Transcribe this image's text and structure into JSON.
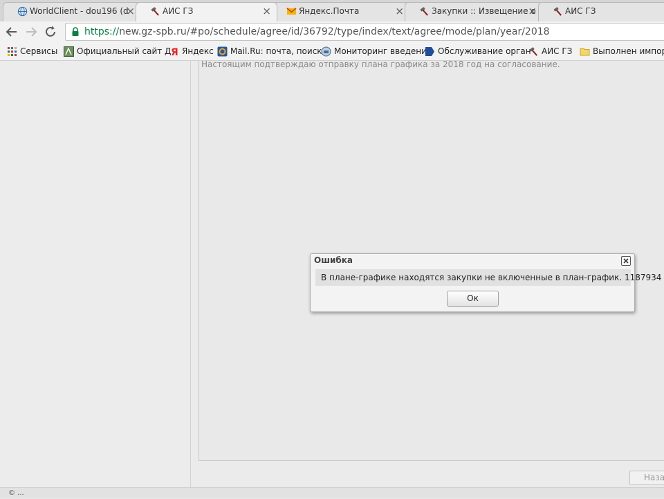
{
  "tabs": [
    {
      "title": "WorldClient - dou196 (d",
      "icon": "globe-icon",
      "active": false
    },
    {
      "title": "АИС ГЗ",
      "icon": "hammer-icon",
      "active": true
    },
    {
      "title": "Яндекс.Почта",
      "icon": "mail-icon",
      "active": false
    },
    {
      "title": "Закупки :: Извещение о",
      "icon": "hammer-icon",
      "active": false
    },
    {
      "title": "АИС ГЗ",
      "icon": "hammer-icon",
      "active": false
    }
  ],
  "address": {
    "scheme": "https://",
    "host_path": "new.gz-spb.ru/#po/schedule/agree/id/36792/type/index/text/agree/mode/plan/year/2018"
  },
  "bookmarks": [
    {
      "label": "Сервисы",
      "icon": "apps-grid-icon"
    },
    {
      "label": "Официальный сайт Д",
      "icon": "site-icon"
    },
    {
      "label": "Яндекс",
      "icon": "yandex-icon"
    },
    {
      "label": "Mail.Ru: почта, поиск",
      "icon": "mailru-icon"
    },
    {
      "label": "Мониторинг введени",
      "icon": "monitoring-icon"
    },
    {
      "label": "Обслуживание орган",
      "icon": "service-icon"
    },
    {
      "label": "АИС ГЗ",
      "icon": "hammer-icon"
    },
    {
      "label": "Выполнен импорт",
      "icon": "folder-icon"
    }
  ],
  "page": {
    "confirm_text": "Настоящим подтверждаю отправку плана графика за 2018 год на согласование.",
    "back_button": "Назад",
    "status": "© ..."
  },
  "dialog": {
    "title": "Ошибка",
    "message": "В плане-графике находятся закупки не включенные в план-график. 1187934",
    "ok_label": "Ок"
  },
  "colors": {
    "secure_green": "#0b8043",
    "dialog_bg": "#f3f3f3"
  }
}
